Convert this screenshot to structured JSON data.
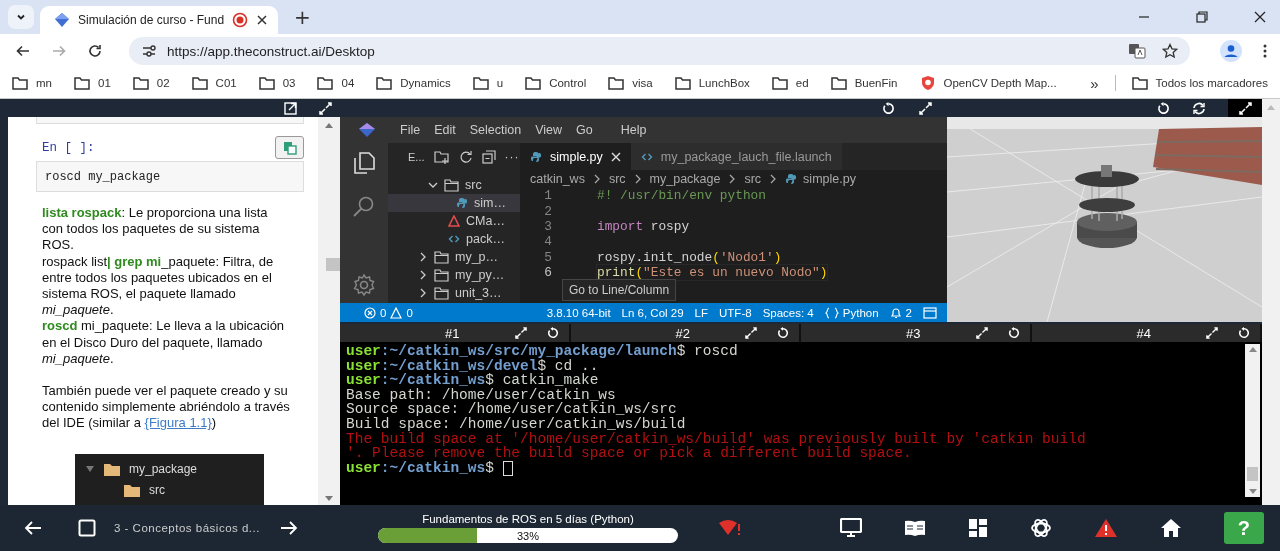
{
  "browser": {
    "tabs": [
      {
        "title": "Simulación de curso - Fund",
        "selected": true,
        "recording": true
      }
    ],
    "new_tab": "+",
    "url": "https://app.theconstruct.ai/Desktop",
    "bookmarks": [
      {
        "label": "mn",
        "kind": "folder"
      },
      {
        "label": "01",
        "kind": "folder"
      },
      {
        "label": "02",
        "kind": "folder"
      },
      {
        "label": "C01",
        "kind": "folder"
      },
      {
        "label": "03",
        "kind": "folder"
      },
      {
        "label": "04",
        "kind": "folder"
      },
      {
        "label": "Dynamics",
        "kind": "folder"
      },
      {
        "label": "u",
        "kind": "folder"
      },
      {
        "label": "Control",
        "kind": "folder"
      },
      {
        "label": "visa",
        "kind": "folder"
      },
      {
        "label": "LunchBox",
        "kind": "folder"
      },
      {
        "label": "ed",
        "kind": "folder"
      },
      {
        "label": "BuenFin",
        "kind": "folder"
      },
      {
        "label": "OpenCV Depth Map...",
        "kind": "site"
      }
    ],
    "more": "»",
    "all_bookmarks": "Todos los marcadores"
  },
  "notebook": {
    "prompt": "En [ ]:",
    "code": "roscd my_package",
    "paragraphs": [
      "**lista rospack**: Le proporciona una lista con todos los paquetes de su sistema ROS.",
      "rospack list**| grep mi**_paquete: Filtra, de entre todos los paquetes ubicados en el sistema ROS, el paquete llamado *mi_paquete*.",
      "**roscd** mi_paquete: Le lleva a la ubicación en el Disco Duro del paquete, llamado *mi_paquete*."
    ],
    "closing": {
      "text": "También puede ver el paquete creado y su contenido simplemente abriéndolo a través del IDE (similar a ",
      "link": "{Figura 1.1}",
      "after": ")"
    },
    "figure": [
      {
        "label": "my_package",
        "expanded": true,
        "children": [
          {
            "label": "src"
          }
        ]
      }
    ]
  },
  "ide": {
    "menu": [
      "File",
      "Edit",
      "Selection",
      "View",
      "Go",
      "Help"
    ],
    "explorer": {
      "title": "E...",
      "more": "···",
      "items": [
        {
          "label": "src",
          "kind": "folder",
          "expanded": true,
          "selected": false,
          "children": [
            {
              "label": "sim…",
              "kind": "python",
              "selected": true
            }
          ]
        },
        {
          "label": "CMa…",
          "kind": "cmake",
          "selected": false
        },
        {
          "label": "pack…",
          "kind": "xml",
          "selected": false
        }
      ],
      "folders": [
        {
          "label": "my_p…",
          "expanded": false
        },
        {
          "label": "my_py…",
          "expanded": false
        },
        {
          "label": "unit_3…",
          "expanded": false
        }
      ]
    },
    "tabs": [
      {
        "label": "simple.py",
        "kind": "python",
        "selected": true
      },
      {
        "label": "my_package_lauch_file.launch",
        "kind": "xml",
        "selected": false
      }
    ],
    "breadcrumb": [
      "catkin_ws",
      "src",
      "my_package",
      "src",
      "simple.py"
    ],
    "lines": [
      {
        "number": "1",
        "current": false,
        "tokens": [
          {
            "t": "#! /usr/bin/env python",
            "kind": "comment"
          }
        ]
      },
      {
        "number": "2",
        "current": false
      },
      {
        "number": "3",
        "current": false,
        "tokens": [
          {
            "t": "import",
            "kind": "keyword"
          },
          {
            "t": " rospy",
            "kind": "plain"
          }
        ]
      },
      {
        "number": "4",
        "current": false
      },
      {
        "number": "5",
        "current": false,
        "tokens": [
          {
            "t": "rospy.init_node",
            "kind": "plain"
          },
          {
            "t": "(",
            "kind": "bracket"
          },
          {
            "t": "'Nodo1'",
            "kind": "string"
          },
          {
            "t": ")",
            "kind": "bracket"
          }
        ]
      },
      {
        "number": "6",
        "current": true,
        "tokens": [
          {
            "t": "print",
            "kind": "function"
          },
          {
            "t": "(",
            "kind": "bracket"
          },
          {
            "t": "\"Este es un nuevo Nodo\"",
            "kind": "string"
          },
          {
            "t": ")",
            "kind": "bracket"
          }
        ]
      }
    ],
    "tooltip": "Go to Line/Column",
    "status": {
      "errors": "0",
      "warnings": "0",
      "items": [
        "3.8.10 64-bit",
        "Ln 6, Col 29",
        "LF",
        "UTF-8",
        "Spaces: 4"
      ],
      "language": "Python",
      "notifications": "2"
    }
  },
  "terminal": {
    "tabs": [
      "#1",
      "#2",
      "#3",
      "#4"
    ],
    "lines": [
      {
        "kind": "prompt",
        "user": "user",
        "path": ":~/catkin_ws/src/my_package/launch",
        "command": "$ roscd"
      },
      {
        "kind": "prompt",
        "user": "user",
        "path": ":~/catkin_ws/devel",
        "command": "$ cd .."
      },
      {
        "kind": "prompt",
        "user": "user",
        "path": ":~/catkin_ws",
        "command": "$ catkin_make"
      },
      {
        "kind": "output",
        "text": "Base path: /home/user/catkin_ws"
      },
      {
        "kind": "output",
        "text": "Source space: /home/user/catkin_ws/src"
      },
      {
        "kind": "output",
        "text": "Build space: /home/user/catkin_ws/build"
      },
      {
        "kind": "error",
        "text": "The build space at '/home/user/catkin_ws/build' was previously built by 'catkin build"
      },
      {
        "kind": "error",
        "text": "'. Please remove the build space or pick a different build space."
      },
      {
        "kind": "prompt",
        "user": "user",
        "path": ":~/catkin_ws",
        "command": "$ ",
        "cursor": true
      }
    ]
  },
  "footer": {
    "lesson": "3 - Conceptos básicos d...",
    "course": "Fundamentos de ROS en 5 días (Python)",
    "progress": {
      "level": 0.33,
      "reading": "33%"
    },
    "help": "?"
  }
}
